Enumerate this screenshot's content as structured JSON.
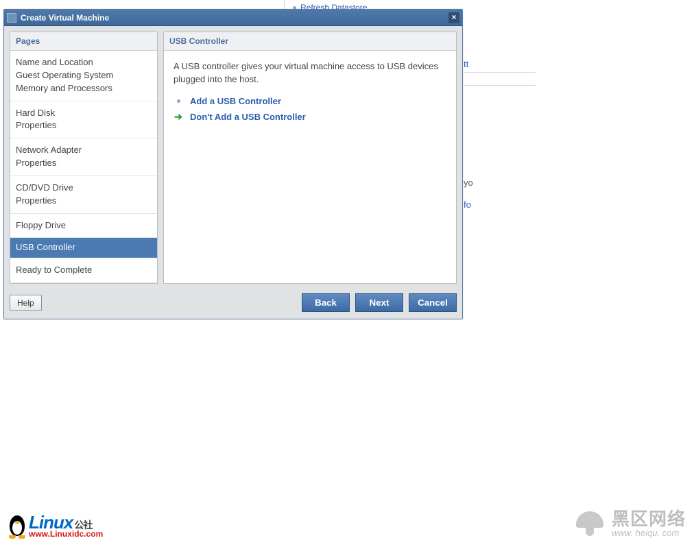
{
  "dialog": {
    "title": "Create Virtual Machine"
  },
  "sidebar": {
    "header": "Pages",
    "groups": [
      {
        "lines": [
          "Name and Location",
          "Guest Operating System",
          "Memory and Processors"
        ],
        "selected": false
      },
      {
        "lines": [
          "Hard Disk",
          "Properties"
        ],
        "selected": false
      },
      {
        "lines": [
          "Network Adapter",
          "Properties"
        ],
        "selected": false
      },
      {
        "lines": [
          "CD/DVD Drive",
          "Properties"
        ],
        "selected": false
      },
      {
        "lines": [
          "Floppy Drive"
        ],
        "selected": false
      },
      {
        "lines": [
          "USB Controller"
        ],
        "selected": true
      },
      {
        "lines": [
          "Ready to Complete"
        ],
        "selected": false
      }
    ]
  },
  "content": {
    "header": "USB Controller",
    "description": "A USB controller gives your virtual machine access to USB devices plugged into the host.",
    "options": {
      "add": "Add a USB Controller",
      "dont_add": "Don't Add a USB Controller"
    }
  },
  "footer": {
    "help": "Help",
    "back": "Back",
    "next": "Next",
    "cancel": "Cancel"
  },
  "background": {
    "frag1": "Refresh Datastore",
    "clip_tt": "tt",
    "clip_yo": "yo",
    "clip_fo": "fo"
  },
  "watermarks": {
    "left_brand": "Linux",
    "left_suffix": "公社",
    "left_url": "www.Linuxidc.com",
    "right_cn": "黑区网络",
    "right_en": "www. heiqu. com"
  }
}
